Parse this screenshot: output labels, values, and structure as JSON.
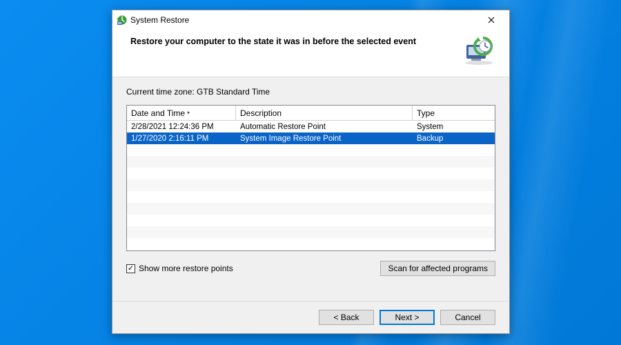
{
  "window": {
    "title": "System Restore",
    "heading": "Restore your computer to the state it was in before the selected event"
  },
  "timezone_label": "Current time zone: GTB Standard Time",
  "columns": {
    "date_time": "Date and Time",
    "description": "Description",
    "type": "Type"
  },
  "rows": [
    {
      "date_time": "2/28/2021 12:24:36 PM",
      "description": "Automatic Restore Point",
      "type": "System",
      "selected": false
    },
    {
      "date_time": "1/27/2020 2:16:11 PM",
      "description": "System Image Restore Point",
      "type": "Backup",
      "selected": true
    }
  ],
  "checkbox": {
    "label": "Show more restore points",
    "checked": true
  },
  "buttons": {
    "scan": "Scan for affected programs",
    "back": "< Back",
    "next": "Next >",
    "cancel": "Cancel"
  }
}
